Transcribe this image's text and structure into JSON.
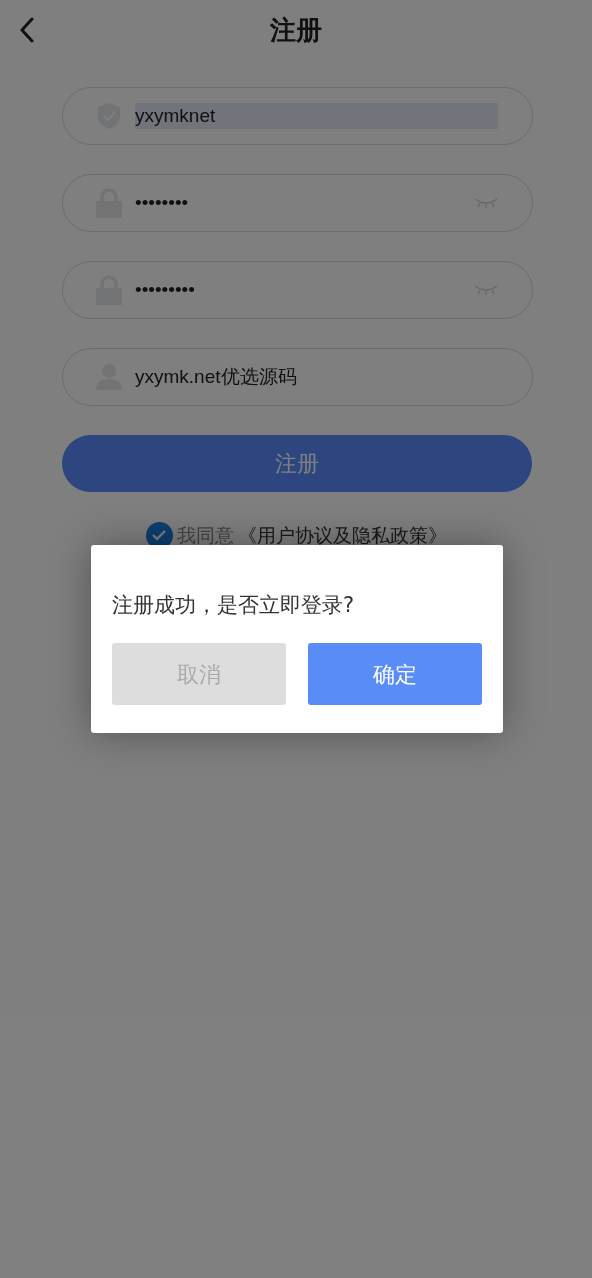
{
  "header": {
    "title": "注册"
  },
  "fields": [
    {
      "kind": "shield",
      "value": "yxymknet",
      "text_selected": true,
      "eye_toggle": false
    },
    {
      "kind": "lock",
      "value": "••••••••",
      "text_selected": false,
      "eye_toggle": true
    },
    {
      "kind": "lock",
      "value": "•••••••••",
      "text_selected": false,
      "eye_toggle": true
    },
    {
      "kind": "person",
      "value": "yxymk.net优选源码",
      "text_selected": false,
      "eye_toggle": false
    }
  ],
  "register_button": "注册",
  "agreement": {
    "checked": true,
    "prefix": "我同意",
    "link": "《用户协议及隐私政策》"
  },
  "dialog": {
    "message": "注册成功，是否立即登录?",
    "buttons": [
      {
        "label": "取消",
        "kind": "cancel"
      },
      {
        "label": "确定",
        "kind": "confirm"
      }
    ]
  }
}
